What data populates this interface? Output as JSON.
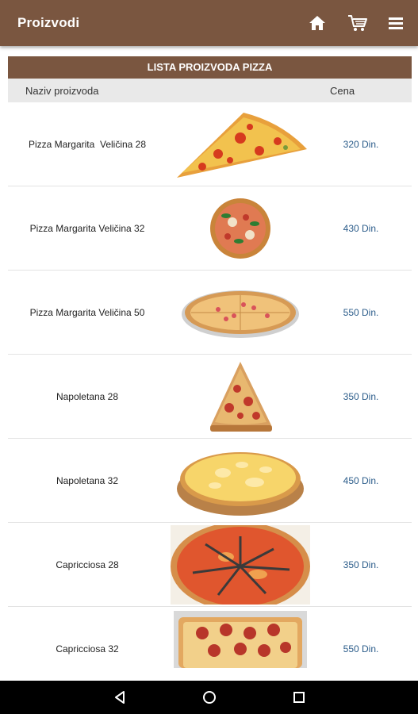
{
  "appbar": {
    "title": "Proizvodi",
    "icons": [
      "home-icon",
      "cart-icon",
      "menu-icon"
    ]
  },
  "list": {
    "header": "LISTA PROIZVODA PIZZA",
    "columns": {
      "name": "Naziv proizvoda",
      "price": "Cena"
    },
    "items": [
      {
        "name": "Pizza Margarita  Veličina 28",
        "price": "320 Din.",
        "image": "pizza-slice-image"
      },
      {
        "name": "Pizza Margarita Veličina 32",
        "price": "430 Din.",
        "image": "pizza-basil-image"
      },
      {
        "name": "Pizza Margarita Veličina 50",
        "price": "550 Din.",
        "image": "pizza-large-image"
      },
      {
        "name": "Napoletana 28",
        "price": "350 Din.",
        "image": "pizza-slice-image"
      },
      {
        "name": "Napoletana 32",
        "price": "450 Din.",
        "image": "pizza-cheese-image"
      },
      {
        "name": "Capricciosa 28",
        "price": "350 Din.",
        "image": "pizza-anchovy-image"
      },
      {
        "name": "Capricciosa 32",
        "price": "550 Din.",
        "image": "pizza-pepperoni-image"
      }
    ]
  },
  "navbar": {
    "icons": [
      "back-icon",
      "home-nav-icon",
      "recents-icon"
    ]
  },
  "colors": {
    "brand": "#7a5640",
    "price": "#2b5c8a",
    "column_header_bg": "#e9e9e9"
  }
}
